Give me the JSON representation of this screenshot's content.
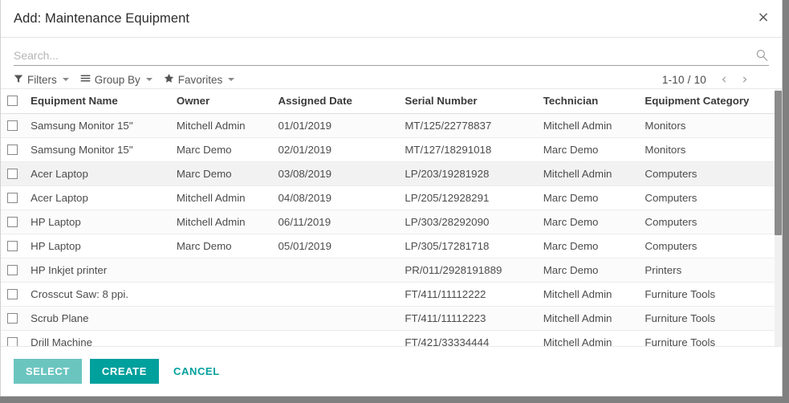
{
  "dialog": {
    "title": "Add: Maintenance Equipment",
    "close_label": "×",
    "close_icon": "close-icon"
  },
  "search": {
    "placeholder": "Search...",
    "value": "",
    "icon": "search-icon"
  },
  "controls": {
    "filters": {
      "label": "Filters",
      "icon": "funnel-icon"
    },
    "group_by": {
      "label": "Group By",
      "icon": "hamburger-icon"
    },
    "favorites": {
      "label": "Favorites",
      "icon": "star-icon"
    }
  },
  "pagination": {
    "range": "1-10 / 10",
    "prev_label": "‹",
    "next_label": "›",
    "prev_icon": "chevron-left-icon",
    "next_icon": "chevron-right-icon"
  },
  "table": {
    "columns": [
      "Equipment Name",
      "Owner",
      "Assigned Date",
      "Serial Number",
      "Technician",
      "Equipment Category"
    ],
    "rows": [
      {
        "name": "Samsung Monitor 15\"",
        "owner": "Mitchell Admin",
        "date": "01/01/2019",
        "serial": "MT/125/22778837",
        "technician": "Mitchell Admin",
        "category": "Monitors"
      },
      {
        "name": "Samsung Monitor 15\"",
        "owner": "Marc Demo",
        "date": "02/01/2019",
        "serial": "MT/127/18291018",
        "technician": "Marc Demo",
        "category": "Monitors"
      },
      {
        "name": "Acer Laptop",
        "owner": "Marc Demo",
        "date": "03/08/2019",
        "serial": "LP/203/19281928",
        "technician": "Mitchell Admin",
        "category": "Computers"
      },
      {
        "name": "Acer Laptop",
        "owner": "Mitchell Admin",
        "date": "04/08/2019",
        "serial": "LP/205/12928291",
        "technician": "Marc Demo",
        "category": "Computers"
      },
      {
        "name": "HP Laptop",
        "owner": "Mitchell Admin",
        "date": "06/11/2019",
        "serial": "LP/303/28292090",
        "technician": "Marc Demo",
        "category": "Computers"
      },
      {
        "name": "HP Laptop",
        "owner": "Marc Demo",
        "date": "05/01/2019",
        "serial": "LP/305/17281718",
        "technician": "Marc Demo",
        "category": "Computers"
      },
      {
        "name": "HP Inkjet printer",
        "owner": "",
        "date": "",
        "serial": "PR/011/2928191889",
        "technician": "Marc Demo",
        "category": "Printers"
      },
      {
        "name": "Crosscut Saw: 8 ppi.",
        "owner": "",
        "date": "",
        "serial": "FT/411/11112222",
        "technician": "Mitchell Admin",
        "category": "Furniture Tools"
      },
      {
        "name": "Scrub Plane",
        "owner": "",
        "date": "",
        "serial": "FT/411/11112223",
        "technician": "Mitchell Admin",
        "category": "Furniture Tools"
      },
      {
        "name": "Drill Machine",
        "owner": "",
        "date": "",
        "serial": "FT/421/33334444",
        "technician": "Mitchell Admin",
        "category": "Furniture Tools"
      }
    ],
    "hovered_row_index": 2
  },
  "footer": {
    "select_label": "SELECT",
    "create_label": "CREATE",
    "cancel_label": "CANCEL"
  },
  "colors": {
    "accent": "#00a09d",
    "accent_light": "#6bc5bf",
    "text": "#4c4c4c",
    "header_text": "#3a3a3a",
    "stripe": "#fbfbfb",
    "hover": "#f2f2f2",
    "page_background": "#808080"
  }
}
